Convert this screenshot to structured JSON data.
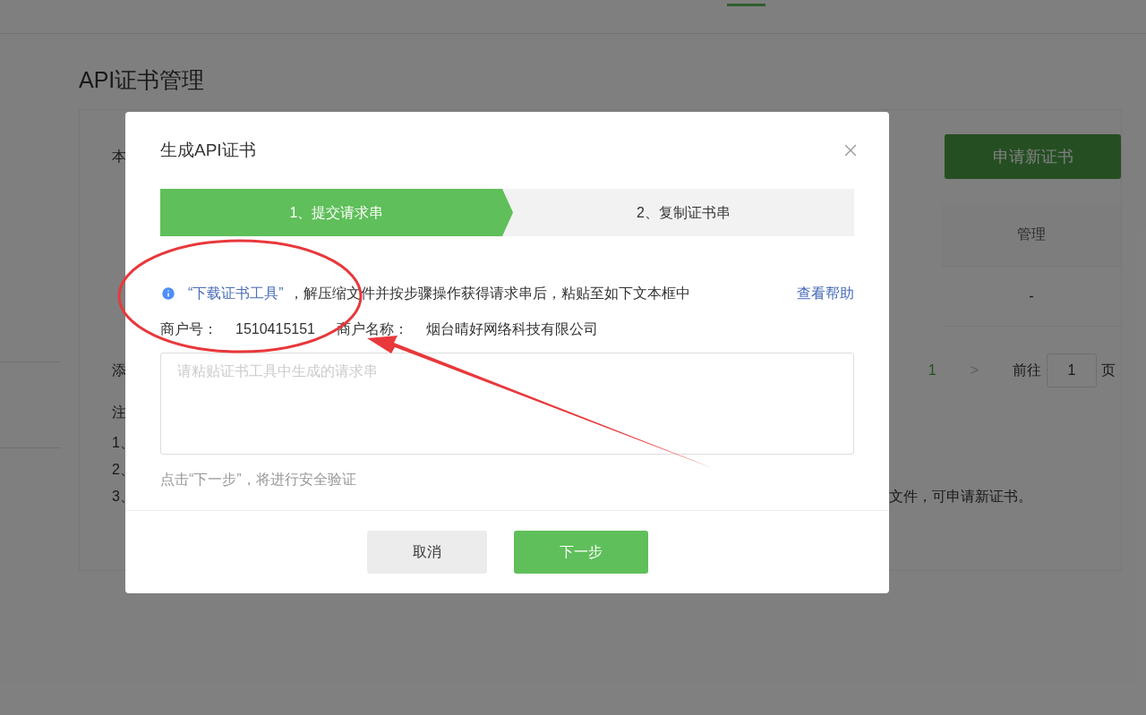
{
  "page": {
    "title": "API证书管理",
    "card": {
      "intro_text": "本",
      "apply_button": "申请新证书",
      "table": {
        "columns": [
          "管理"
        ],
        "rows": [
          [
            "-"
          ]
        ]
      },
      "add_text": "添",
      "pagination": {
        "pages": [
          {
            "label": "1",
            "selected": true
          }
        ],
        "next": ">",
        "goto_label": "前往",
        "goto_value": "1",
        "page_unit": "页"
      },
      "notes_title": "注",
      "notes": [
        {
          "number": "1、"
        },
        {
          "number": "2、"
        },
        {
          "number": "3、",
          "tail": "文件，可申请新证书。"
        }
      ]
    }
  },
  "dialog": {
    "title": "生成API证书",
    "steps": [
      {
        "label": "1、提交请求串",
        "selected": true
      },
      {
        "label": "2、复制证书串",
        "selected": false
      }
    ],
    "info": {
      "link": "“下载证书工具”",
      "text": "，解压缩文件并按步骤操作获得请求串后，粘贴至如下文本框中",
      "help_link": "查看帮助"
    },
    "merchant": [
      {
        "label": "商户号：",
        "value": "1510415151"
      },
      {
        "label": "商户名称：",
        "value": "烟台晴好网络科技有限公司"
      }
    ],
    "textarea": {
      "placeholder": "请粘贴证书工具中生成的请求串"
    },
    "hint": "点击“下一步”，将进行安全验证",
    "buttons": [
      {
        "label": "取消",
        "kind": "secondary"
      },
      {
        "label": "下一步",
        "kind": "primary"
      }
    ]
  }
}
